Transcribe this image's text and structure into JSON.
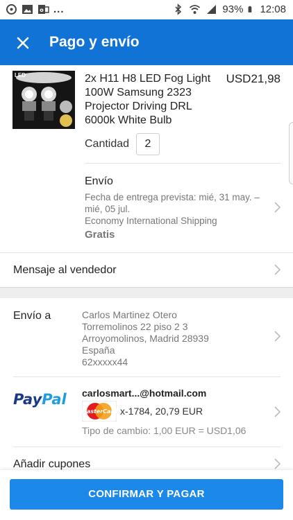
{
  "status_bar": {
    "battery": "93%",
    "time": "12:08",
    "overflow": "..."
  },
  "app_bar": {
    "title": "Pago y envío",
    "close_icon": "close-icon"
  },
  "product": {
    "image_badge": "LED",
    "title": "2x H11 H8 LED Fog Light 100W Samsung 2323 Projector Driving DRL 6000k White Bulb",
    "price": "USD21,98",
    "quantity_label": "Cantidad",
    "quantity": "2"
  },
  "shipping": {
    "title": "Envío",
    "delivery": "Fecha de entrega prevista: mié, 31 may. – mié, 05 jul.",
    "method": "Economy International Shipping",
    "price": "Gratis"
  },
  "seller_message": {
    "label": "Mensaje al vendedor"
  },
  "address": {
    "label": "Envío a",
    "lines": [
      "Carlos Martinez Otero",
      "Torremolinos 22 piso 2 3",
      "Arroyomolinos, Madrid 28939",
      "España",
      "62xxxxx44"
    ]
  },
  "payment": {
    "logo_pay": "Pay",
    "logo_pal": "Pal",
    "email": "carlosmart...@hotmail.com",
    "card_logo_text": "MasterCard",
    "card": "x-1784, 20,79 EUR",
    "rate": "Tipo de cambio: 1,00 EUR = USD1,06"
  },
  "coupons": {
    "label": "Añadir cupones"
  },
  "confirm_button": "CONFIRMAR Y PAGAR",
  "colors": {
    "app_bar": "#1173d6",
    "button": "#1b88ea",
    "paypal_dark": "#1a3a86",
    "paypal_light": "#1f9de0"
  }
}
